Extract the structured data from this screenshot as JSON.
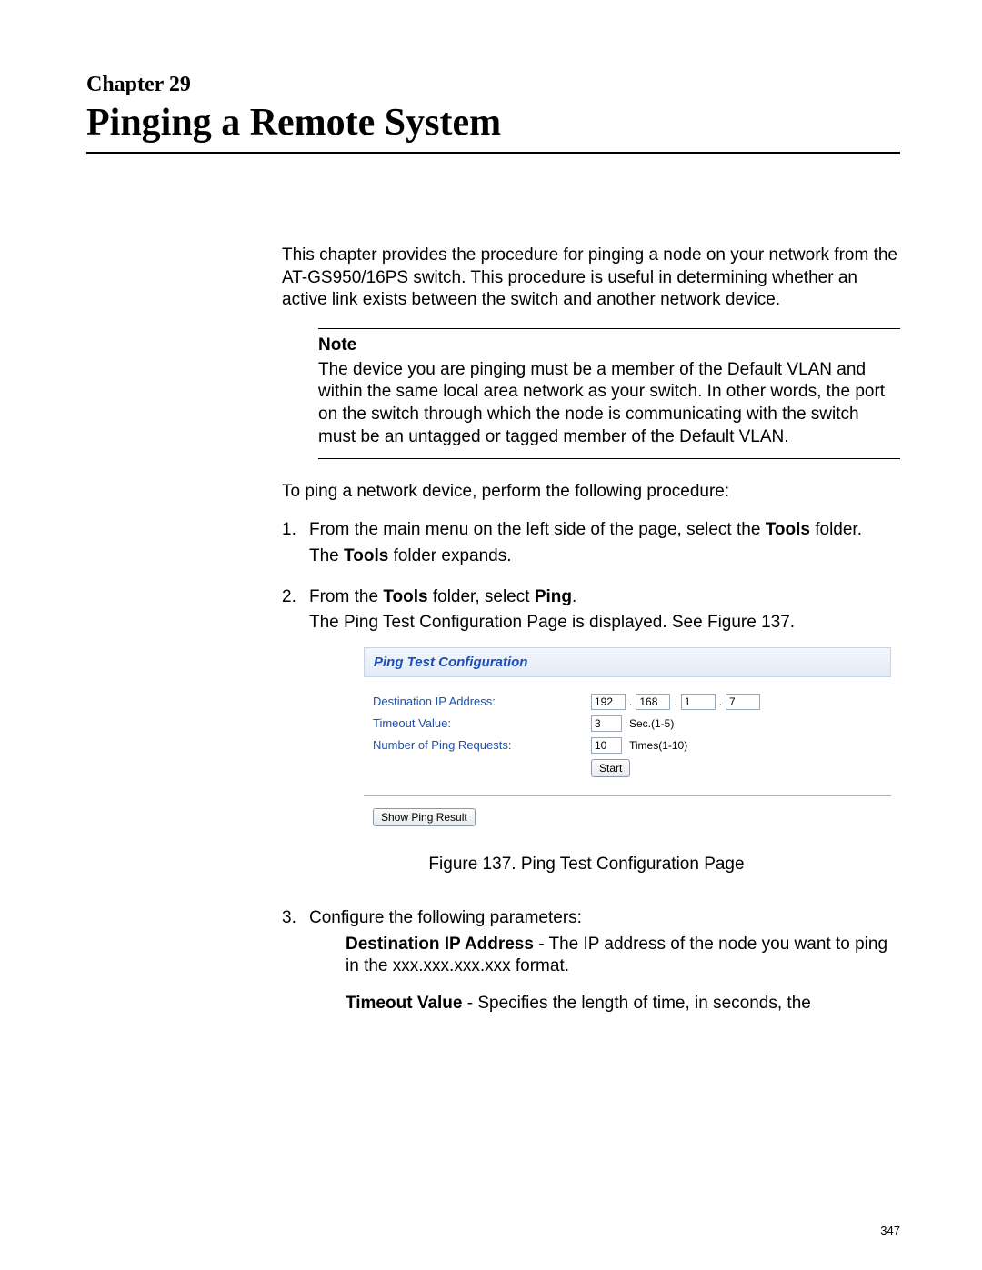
{
  "header": {
    "chapter_label": "Chapter 29",
    "chapter_title": "Pinging a Remote System"
  },
  "intro": "This chapter provides the procedure for pinging a node on your network from the AT-GS950/16PS switch. This procedure is useful in determining whether an active link exists between the switch and another network device.",
  "note": {
    "title": "Note",
    "body": "The device you are pinging must be a member of the Default VLAN and within the same local area network as your switch. In other words, the port on the switch through which the node is communicating with the switch must be an untagged or tagged member of the Default VLAN."
  },
  "procedure_intro": "To ping a network device, perform the following procedure:",
  "steps": {
    "s1": {
      "num": "1.",
      "line1_pre": "From the main menu on the left side of the page, select the ",
      "line1_bold": "Tools",
      "line1_post": " folder.",
      "line2_pre": "The ",
      "line2_bold": "Tools",
      "line2_post": " folder expands."
    },
    "s2": {
      "num": "2.",
      "line1_pre": "From the ",
      "line1_bold1": "Tools",
      "line1_mid": " folder, select ",
      "line1_bold2": "Ping",
      "line1_post": ".",
      "line2": "The Ping Test Configuration Page is displayed. See Figure 137."
    },
    "s3": {
      "num": "3.",
      "text": "Configure the following parameters:"
    }
  },
  "figure": {
    "header": "Ping Test Configuration",
    "labels": {
      "dest_ip": "Destination IP Address:",
      "timeout": "Timeout Value:",
      "requests": "Number of Ping Requests:"
    },
    "values": {
      "ip1": "192",
      "ip2": "168",
      "ip3": "1",
      "ip4": "7",
      "timeout": "3",
      "requests": "10"
    },
    "units": {
      "timeout": "Sec.(1-5)",
      "requests": "Times(1-10)"
    },
    "buttons": {
      "start": "Start",
      "show_result": "Show Ping Result"
    },
    "caption": "Figure 137. Ping Test Configuration Page"
  },
  "params": {
    "dest_ip": {
      "label": "Destination IP Address",
      "text": " - The IP address of the node you want to ping in the xxx.xxx.xxx.xxx format."
    },
    "timeout": {
      "label": "Timeout Value",
      "text": " - Specifies the length of time, in seconds, the"
    }
  },
  "page_number": "347"
}
